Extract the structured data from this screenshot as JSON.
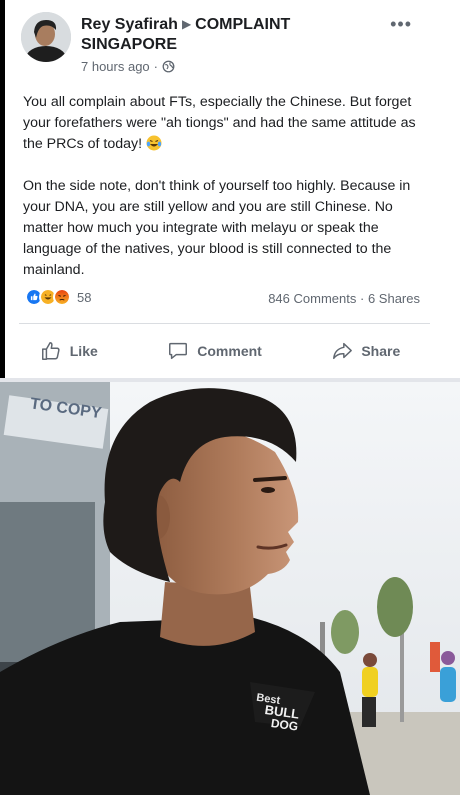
{
  "post": {
    "author": "Rey Syafirah",
    "group": "COMPLAINT SINGAPORE",
    "timestamp": "7 hours ago",
    "more_icon": "ellipsis-icon",
    "paragraph1": "You all complain about FTs, especially the Chinese. But forget your forefathers were \"ah tiongs\" and had the same attitude as the PRCs of today!",
    "paragraph2": "On the side note, don't think of yourself too highly. Because in your DNA, you are still yellow and you are still Chinese. No matter how much you integrate with melayu or speak the language of the natives, your blood is still connected to the mainland.",
    "reaction_count": "58",
    "comments": "846 Comments",
    "shares": "6 Shares",
    "stats_separator": "·"
  },
  "actions": {
    "like": "Like",
    "comment": "Comment",
    "share": "Share"
  },
  "photo": {
    "shirt_text_line1": "Best",
    "shirt_text_line2": "BULL",
    "shirt_text_line3": "DOG",
    "sign_text": "TO COPY"
  },
  "colors": {
    "like_blue": "#1877f2",
    "haha_yellow": "#f7b125",
    "angry_orange": "#e9710f",
    "text_gray": "#606770"
  }
}
